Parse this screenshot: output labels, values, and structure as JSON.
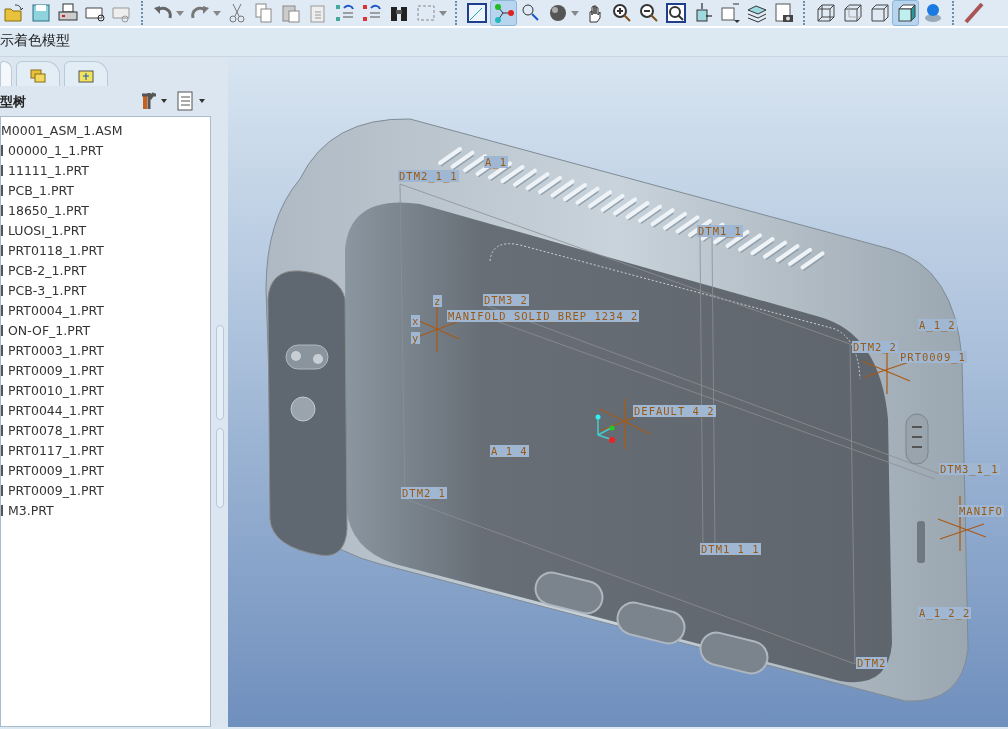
{
  "toolbar": [
    {
      "selected": false
    },
    {
      "selected": false
    },
    {
      "selected": false
    },
    {
      "selected": false
    },
    {
      "selected": false
    },
    {
      "selected": false
    },
    {
      "selected": false
    },
    {
      "selected": false
    },
    {
      "selected": false
    },
    {
      "selected": false
    },
    {
      "selected": false
    },
    {
      "selected": false
    },
    {
      "selected": false
    },
    {
      "selected": false
    },
    {
      "selected": false
    },
    {
      "selected": false
    },
    {
      "selected": true
    },
    {
      "selected": false
    },
    {
      "selected": false
    },
    {
      "selected": false
    },
    {
      "selected": false
    },
    {
      "selected": false
    },
    {
      "selected": false
    },
    {
      "selected": false
    },
    {
      "selected": false
    },
    {
      "selected": false
    },
    {
      "selected": false
    },
    {
      "selected": false
    },
    {
      "selected": false
    },
    {
      "selected": false
    },
    {
      "selected": true
    },
    {
      "selected": false
    },
    {
      "selected": false
    }
  ],
  "prompt": "示着色模型",
  "navigator": {
    "tabs": [
      {
        "selected": true
      },
      {
        "selected": false
      },
      {
        "selected": false
      }
    ],
    "title": "型树",
    "tree": [
      "M0001_ASM_1.ASM",
      "00000_1_1.PRT",
      "11111_1.PRT",
      "PCB_1.PRT",
      "18650_1.PRT",
      "LUOSI_1.PRT",
      "PRT0118_1.PRT",
      "PCB-2_1.PRT",
      "PCB-3_1.PRT",
      "PRT0004_1.PRT",
      "ON-OF_1.PRT",
      "PRT0003_1.PRT",
      "PRT0009_1.PRT",
      "PRT0010_1.PRT",
      "PRT0044_1.PRT",
      "PRT0078_1.PRT",
      "PRT0117_1.PRT",
      "PRT0009_1.PRT",
      "PRT0009_1.PRT",
      "M3.PRT"
    ]
  },
  "viewport": {
    "datum_labels": [
      "A_1",
      "DTM2_1_1",
      "DTM1_1",
      "DTM3_2",
      "MANIFOLD_SOLID_BREP_1234_2",
      "z",
      "x",
      "y",
      "A_1_2",
      "DTM2_2",
      "PRT0009_1",
      "DEFAULT_4_2",
      "A_1_4",
      "DTM3_1_1",
      "DTM2_1",
      "MANIFO",
      "DTM1_1_1",
      "A_1_2_2",
      "DTM2"
    ]
  }
}
